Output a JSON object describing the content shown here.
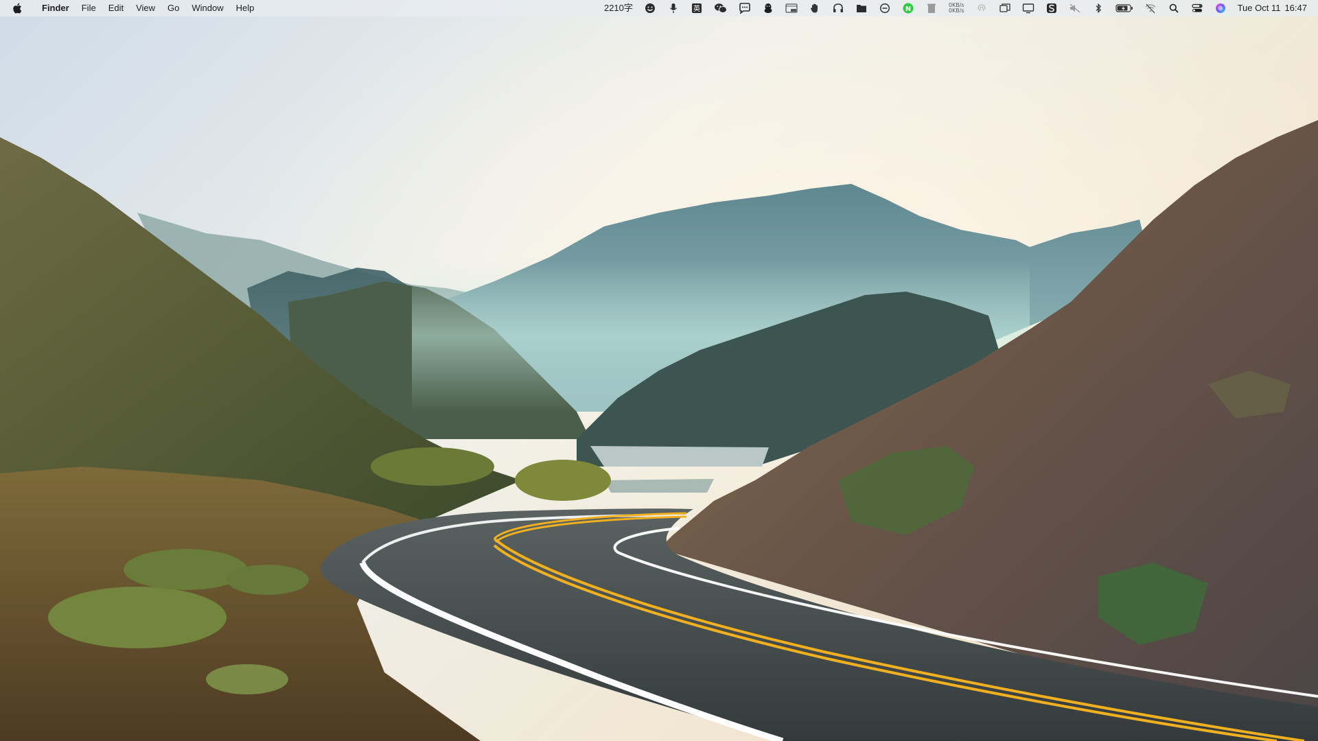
{
  "menubar": {
    "app_name": "Finder",
    "menus": [
      "File",
      "Edit",
      "View",
      "Go",
      "Window",
      "Help"
    ],
    "input_counter": "2210字",
    "ime_label": "英",
    "net_up": "0KB/s",
    "net_down": "0KB/s",
    "date": "Tue Oct 11",
    "time": "16:47"
  },
  "status_icons": [
    "smiley-face-icon",
    "microphone-icon",
    "input-method-icon",
    "wechat-icon",
    "chat-bubble-icon",
    "qq-penguin-icon",
    "ssh-terminal-icon",
    "hand-icon",
    "headphones-icon",
    "folder-icon",
    "do-not-disturb-icon",
    "green-n-app-icon",
    "trash-bin-icon",
    "network-speed-icon",
    "fingerprint-icon",
    "window-stack-icon",
    "display-icon",
    "s-app-icon",
    "muted-icon",
    "bluetooth-icon",
    "battery-icon",
    "wifi-off-icon",
    "spotlight-search-icon",
    "control-center-icon",
    "siri-icon"
  ],
  "colors": {
    "menubar_bg": "#e8ecf0",
    "sky_top": "#d9e4ee",
    "sky_glow": "#f4ead8",
    "mountain_blue": "#4f7680",
    "hill_green": "#5e6a3c",
    "road_asphalt": "#3f4646",
    "road_center_line": "#f0b020",
    "road_edge_line": "#ffffff"
  }
}
